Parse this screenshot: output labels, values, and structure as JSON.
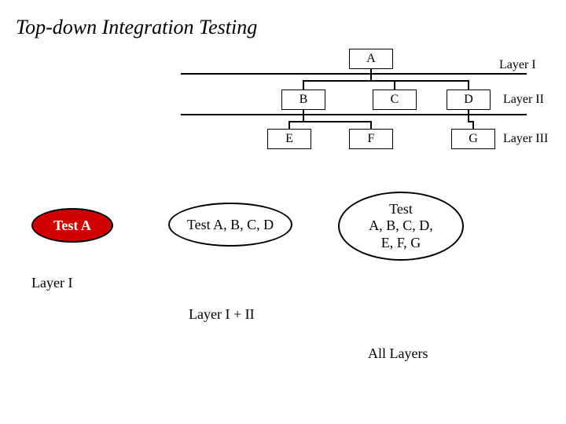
{
  "title": "Top-down Integration Testing",
  "tree": {
    "A": "A",
    "B": "B",
    "C": "C",
    "D": "D",
    "E": "E",
    "F": "F",
    "G": "G"
  },
  "layers": {
    "l1": "Layer I",
    "l2": "Layer II",
    "l3": "Layer III"
  },
  "tests": {
    "t1": "Test A",
    "t2": "Test A, B, C, D",
    "t3_line1": "Test",
    "t3_line2": "A, B, C, D,",
    "t3_line3": "E, F, G"
  },
  "phases": {
    "p1": "Layer I",
    "p2": "Layer I + II",
    "p3": "All Layers"
  }
}
